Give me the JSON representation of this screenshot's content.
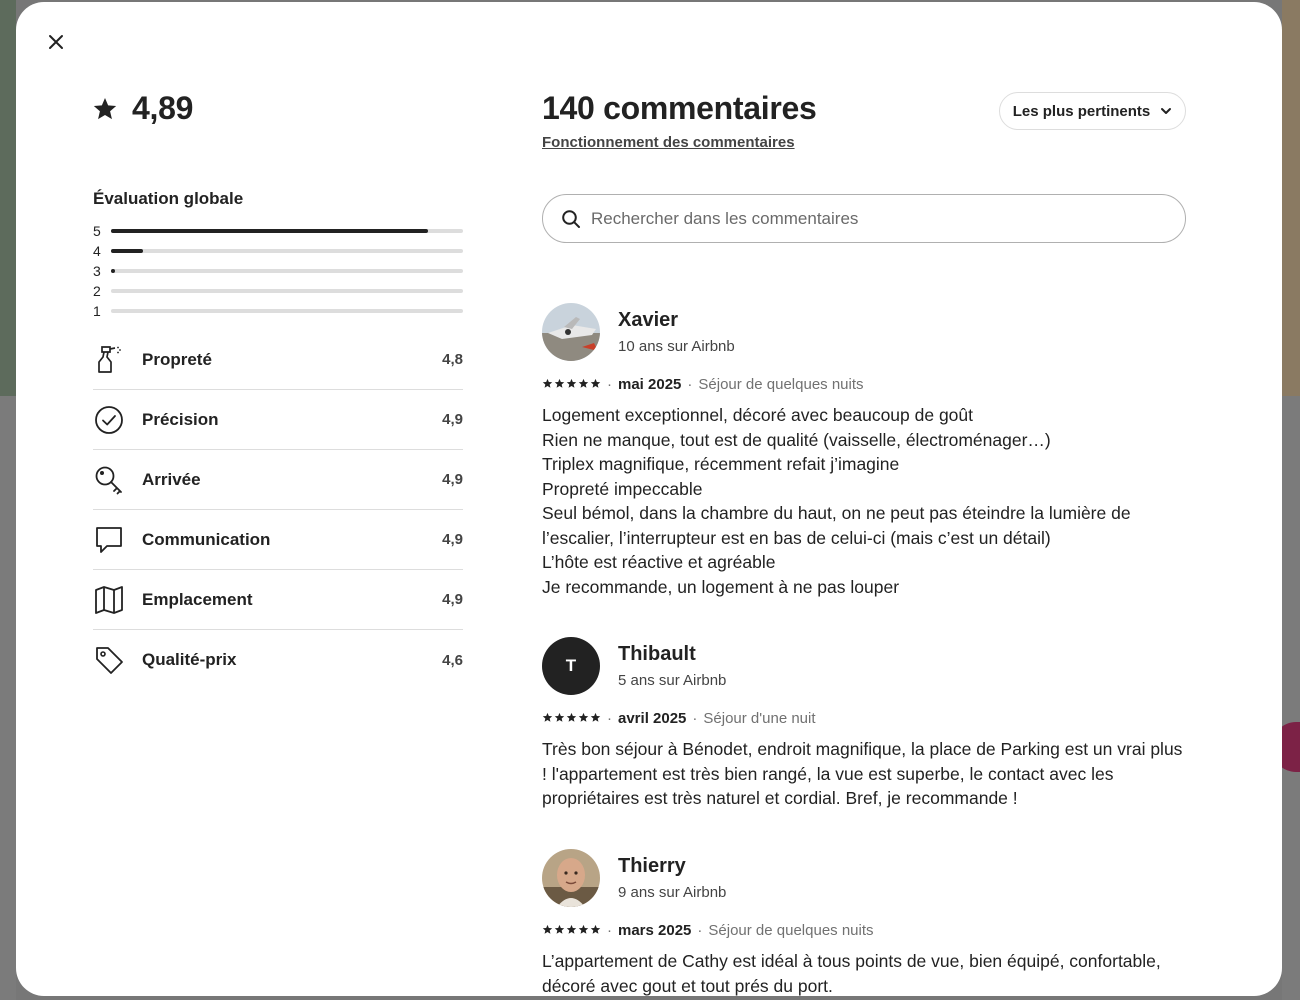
{
  "modal": {
    "close_label": "Fermer"
  },
  "summary": {
    "rating": "4,89",
    "overall_title": "Évaluation globale",
    "distribution": [
      {
        "label": "5",
        "fraction": 0.9
      },
      {
        "label": "4",
        "fraction": 0.09
      },
      {
        "label": "3",
        "fraction": 0.01
      },
      {
        "label": "2",
        "fraction": 0.0
      },
      {
        "label": "1",
        "fraction": 0.0
      }
    ],
    "categories": [
      {
        "label": "Propreté",
        "score": "4,8",
        "icon": "spray-bottle-icon"
      },
      {
        "label": "Précision",
        "score": "4,9",
        "icon": "check-circle-icon"
      },
      {
        "label": "Arrivée",
        "score": "4,9",
        "icon": "key-icon"
      },
      {
        "label": "Communication",
        "score": "4,9",
        "icon": "chat-bubble-icon"
      },
      {
        "label": "Emplacement",
        "score": "4,9",
        "icon": "map-icon"
      },
      {
        "label": "Qualité-prix",
        "score": "4,6",
        "icon": "price-tag-icon"
      }
    ]
  },
  "reviews_header": {
    "title": "140 commentaires",
    "how_link": "Fonctionnement des commentaires",
    "sort_label": "Les plus pertinents",
    "search_placeholder": "Rechercher dans les commentaires"
  },
  "reviews": [
    {
      "name": "Xavier",
      "tenure": "10 ans sur Airbnb",
      "stars": 5,
      "date": "mai 2025",
      "stay": "Séjour de quelques nuits",
      "avatar": "photo",
      "lines": [
        "Logement exceptionnel, décoré avec beaucoup de goût",
        "Rien ne manque, tout est de qualité (vaisselle, électroménager…)",
        "Triplex magnifique, récemment refait j’imagine",
        "Propreté impeccable",
        "Seul bémol, dans la chambre du haut, on ne peut pas éteindre la lumière de",
        "l’escalier, l’interrupteur est en bas de celui-ci (mais c’est un détail)",
        "L’hôte est réactive et agréable",
        "Je recommande, un logement à ne pas louper"
      ]
    },
    {
      "name": "Thibault",
      "tenure": "5 ans sur Airbnb",
      "stars": 5,
      "date": "avril 2025",
      "stay": "Séjour d'une nuit",
      "avatar": "initial",
      "initial": "T",
      "lines": [
        "Très bon séjour à Bénodet, endroit magnifique, la place de Parking est un vrai plus",
        "! l'appartement est très bien rangé, la vue est superbe, le contact avec les",
        "propriétaires est très naturel et cordial. Bref, je recommande !"
      ]
    },
    {
      "name": "Thierry",
      "tenure": "9 ans sur Airbnb",
      "stars": 5,
      "date": "mars 2025",
      "stay": "Séjour de quelques nuits",
      "avatar": "photo",
      "lines": [
        "L’appartement de Cathy est idéal à tous points de vue, bien équipé, confortable,",
        "décoré avec gout et tout prés du port."
      ]
    }
  ],
  "backdrop": {
    "accent_pink": "#E00B5B"
  }
}
